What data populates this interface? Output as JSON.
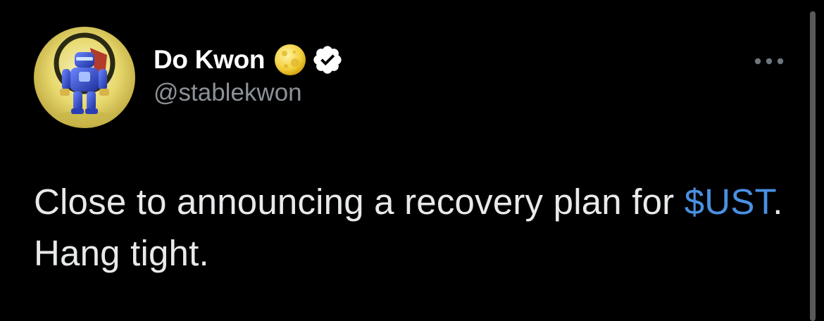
{
  "author": {
    "display_name": "Do Kwon",
    "handle": "@stablekwon",
    "name_emoji": "full-moon-emoji",
    "verified": true,
    "avatar_icon": "robot-avatar"
  },
  "menu": {
    "icon": "more-options-icon"
  },
  "tweet": {
    "text_before": "Close to announcing a recovery plan for ",
    "cashtag": "$UST",
    "text_after": ". Hang tight."
  },
  "colors": {
    "background": "#000000",
    "text": "#e7e9ea",
    "handle": "#8b9298",
    "link": "#4a90e2",
    "verified": "#ffffff"
  }
}
